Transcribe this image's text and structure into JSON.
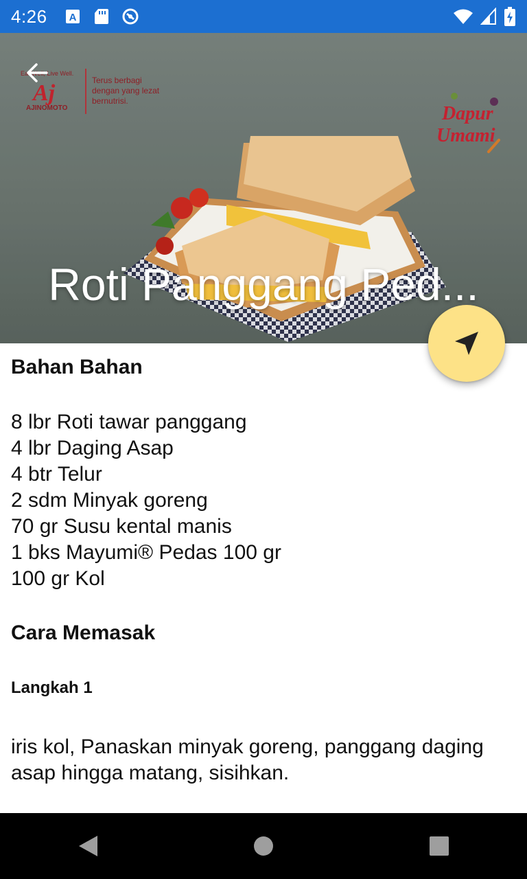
{
  "status_bar": {
    "time": "4:26",
    "background_color": "#1c6fd1",
    "left_icons": [
      "text-a-icon",
      "sd-card-icon",
      "sync-icon"
    ],
    "right_icons": [
      "wifi-icon",
      "signal-icon",
      "battery-icon"
    ]
  },
  "hero": {
    "title": "Roti Panggang Ped...",
    "brand": {
      "tagline_line1": "Eat Well, Live Well.",
      "logo_mark": "Aj",
      "logo_name": "AJINOMOTO",
      "slogan_line1": "Terus berbagi",
      "slogan_line2": "dengan yang lezat",
      "slogan_line3": "bernutrisi."
    },
    "dapur_logo": {
      "line1": "Dapur",
      "line2": "Umami"
    }
  },
  "fab": {
    "icon": "navigation-icon",
    "color": "#fde287"
  },
  "recipe": {
    "ingredients_title": "Bahan Bahan",
    "ingredients": [
      "8 lbr Roti tawar panggang",
      "4 lbr Daging Asap",
      "4 btr Telur",
      "2 sdm Minyak goreng",
      "70 gr Susu kental manis",
      "1 bks Mayumi® Pedas 100 gr",
      "100 gr Kol"
    ],
    "method_title": "Cara Memasak",
    "steps": [
      {
        "label": "Langkah 1",
        "text": "iris kol, Panaskan minyak goreng, panggang daging asap hingga matang, sisihkan."
      }
    ]
  },
  "nav_bar": {
    "buttons": [
      "back-triangle-icon",
      "home-circle-icon",
      "recents-square-icon"
    ]
  }
}
